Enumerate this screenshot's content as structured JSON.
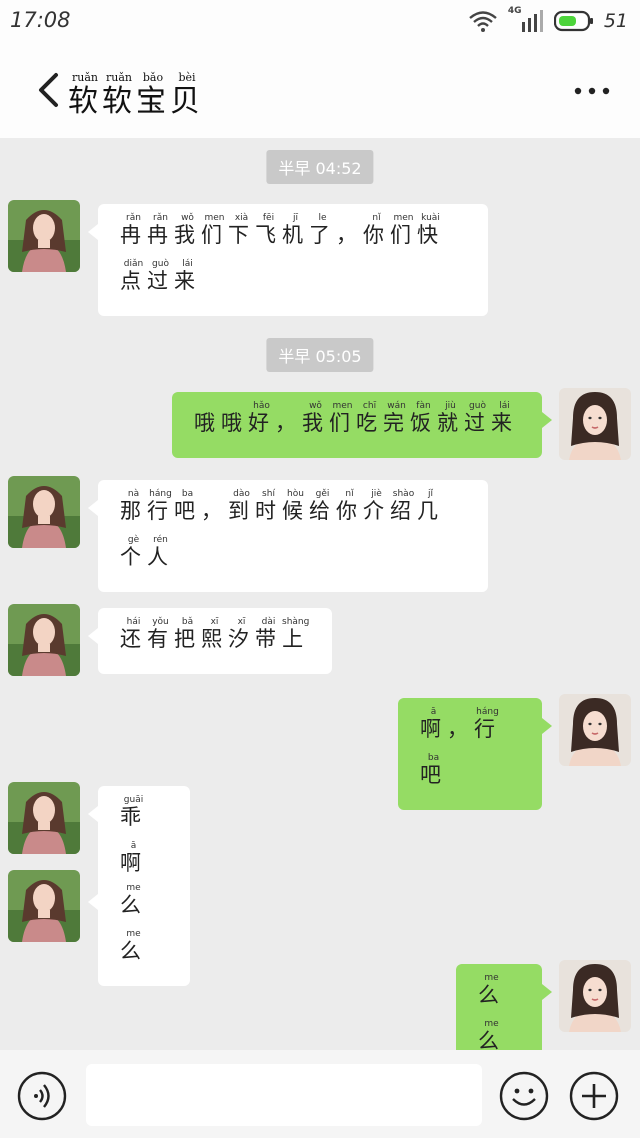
{
  "status": {
    "time": "17:08",
    "network": "4G",
    "battery": "51"
  },
  "header": {
    "title": [
      {
        "ch": "软",
        "py": "ruǎn"
      },
      {
        "ch": "软",
        "py": "ruǎn"
      },
      {
        "ch": "宝",
        "py": "bǎo"
      },
      {
        "ch": "贝",
        "py": "bèi"
      }
    ]
  },
  "messages": [
    {
      "kind": "time",
      "text": "半早 04:52"
    },
    {
      "kind": "msg",
      "side": "in",
      "tokens": [
        {
          "ch": "冉",
          "py": "rǎn"
        },
        {
          "ch": "冉",
          "py": "rǎn"
        },
        {
          "ch": "我",
          "py": "wǒ"
        },
        {
          "ch": "们",
          "py": "men"
        },
        {
          "ch": "下",
          "py": "xià"
        },
        {
          "ch": "飞",
          "py": "fēi"
        },
        {
          "ch": "机",
          "py": "jī"
        },
        {
          "ch": "了",
          "py": "le"
        },
        {
          "ch": "，",
          "py": ""
        },
        {
          "ch": "你",
          "py": "nǐ"
        },
        {
          "ch": "们",
          "py": "men"
        },
        {
          "ch": "快",
          "py": "kuài"
        },
        {
          "ch": "点",
          "py": "diǎn"
        },
        {
          "ch": "过",
          "py": "guò"
        },
        {
          "ch": "来",
          "py": "lái"
        }
      ]
    },
    {
      "kind": "time",
      "text": "半早 05:05"
    },
    {
      "kind": "msg",
      "side": "out",
      "tokens": [
        {
          "ch": "哦",
          "py": ""
        },
        {
          "ch": "哦",
          "py": ""
        },
        {
          "ch": "好",
          "py": "hǎo"
        },
        {
          "ch": "，",
          "py": ""
        },
        {
          "ch": "我",
          "py": "wǒ"
        },
        {
          "ch": "们",
          "py": "men"
        },
        {
          "ch": "吃",
          "py": "chī"
        },
        {
          "ch": "完",
          "py": "wán"
        },
        {
          "ch": "饭",
          "py": "fàn"
        },
        {
          "ch": "就",
          "py": "jiù"
        },
        {
          "ch": "过",
          "py": "guò"
        },
        {
          "ch": "来",
          "py": "lái"
        }
      ]
    },
    {
      "kind": "msg",
      "side": "in",
      "tokens": [
        {
          "ch": "那",
          "py": "nà"
        },
        {
          "ch": "行",
          "py": "háng"
        },
        {
          "ch": "吧",
          "py": "ba"
        },
        {
          "ch": "，",
          "py": ""
        },
        {
          "ch": "到",
          "py": "dào"
        },
        {
          "ch": "时",
          "py": "shí"
        },
        {
          "ch": "候",
          "py": "hòu"
        },
        {
          "ch": "给",
          "py": "gěi"
        },
        {
          "ch": "你",
          "py": "nǐ"
        },
        {
          "ch": "介",
          "py": "jiè"
        },
        {
          "ch": "绍",
          "py": "shào"
        },
        {
          "ch": "几",
          "py": "jǐ"
        },
        {
          "ch": "个",
          "py": "gè"
        },
        {
          "ch": "人",
          "py": "rén"
        }
      ]
    },
    {
      "kind": "msg",
      "side": "in",
      "tokens": [
        {
          "ch": "还",
          "py": "hái"
        },
        {
          "ch": "有",
          "py": "yǒu"
        },
        {
          "ch": "把",
          "py": "bǎ"
        },
        {
          "ch": "熙",
          "py": "xī"
        },
        {
          "ch": "汐",
          "py": "xī"
        },
        {
          "ch": "带",
          "py": "dài"
        },
        {
          "ch": "上",
          "py": "shàng"
        }
      ]
    },
    {
      "kind": "msg",
      "side": "out",
      "tokens": [
        {
          "ch": "啊",
          "py": "ā"
        },
        {
          "ch": "，",
          "py": ""
        },
        {
          "ch": "行",
          "py": "háng"
        },
        {
          "ch": "吧",
          "py": "ba"
        }
      ]
    },
    {
      "kind": "msg",
      "side": "in",
      "tokens": [
        {
          "ch": "乖",
          "py": "guāi"
        },
        {
          "ch": "啊",
          "py": "ā"
        }
      ]
    },
    {
      "kind": "msg",
      "side": "in",
      "tokens": [
        {
          "ch": "么",
          "py": "me"
        },
        {
          "ch": "么",
          "py": "me"
        }
      ]
    },
    {
      "kind": "msg",
      "side": "out",
      "tokens": [
        {
          "ch": "么",
          "py": "me"
        },
        {
          "ch": "么",
          "py": "me"
        }
      ]
    }
  ],
  "input": {
    "value": "",
    "placeholder": ""
  },
  "icons": {
    "back": "chevron-left-icon",
    "more": "more-dots-icon",
    "voice": "voice-icon",
    "emoji": "emoji-icon",
    "plus": "plus-icon",
    "wifi": "wifi-icon",
    "signal": "signal-icon",
    "battery": "battery-icon"
  },
  "colors": {
    "out_bubble": "#95dc64",
    "in_bubble": "#ffffff",
    "chat_bg": "#ececec",
    "battery": "#4cd43a"
  }
}
